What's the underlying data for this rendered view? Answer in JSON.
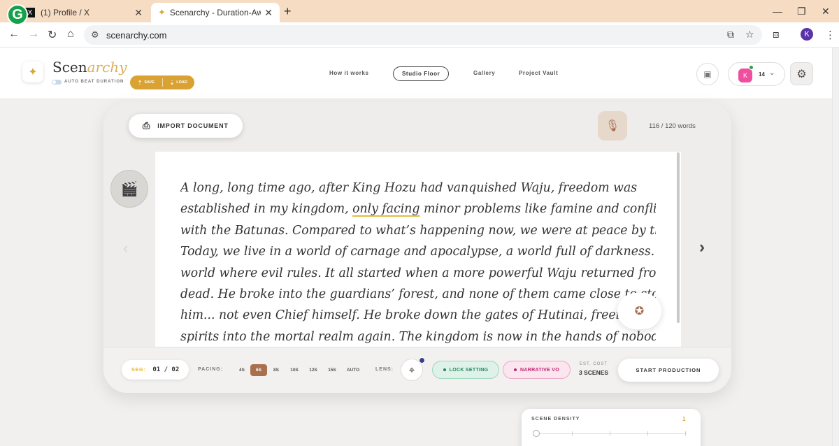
{
  "browser": {
    "tabs": [
      {
        "title": "(1) Profile / X",
        "favicon": "x-logo-icon"
      },
      {
        "title": "Scenarchy - Duration-Aware Vi",
        "favicon": "scenarchy-logo-icon"
      }
    ],
    "url": "scenarchy.com",
    "profile_initial": "K"
  },
  "header": {
    "brand_main": "Scen",
    "brand_accent": "archy",
    "auto_beat_label": "AUTO BEAT DURATION",
    "save_label": "SAVE",
    "load_label": "LOAD",
    "nav": [
      "How it works",
      "Studio Floor",
      "Gallery",
      "Project Vault"
    ],
    "active_nav": "Studio Floor",
    "user_initial": "K",
    "credits": "14"
  },
  "studio": {
    "import_label": "IMPORT DOCUMENT",
    "word_count": "116 / 120 words",
    "story_lines": [
      [
        "A long, long time ago, after King Hozu had vanquished Waju, freedom was",
        "",
        ""
      ],
      [
        "established in my kingdom, ",
        "only facing",
        " minor problems like famine and conflicts"
      ],
      [
        "with the Batunas. Compared to what’s happening now, we were at peace by then.",
        "",
        ""
      ],
      [
        "Today, we live in a world of carnage and apocalypse, a world full of darkness. A",
        "",
        ""
      ],
      [
        "world where evil rules. It all started when a more powerful Waju returned from the",
        "",
        ""
      ],
      [
        "dead. He broke into the guardians’ forest, and none of them came close to stoppin",
        "",
        ""
      ],
      [
        "him... not even Chief himself. He broke down the gates of Hutinai, freeing all the",
        "",
        ""
      ],
      [
        "spirits into the mortal realm again. The kingdom is now in the hands of nobody.",
        "",
        ""
      ]
    ]
  },
  "controls": {
    "seg_label": "SEG:",
    "seg_value": "01 / 02",
    "pacing_label": "PACING:",
    "pacing_options": [
      "4S",
      "6S",
      "8S",
      "10S",
      "12S",
      "15S",
      "AUTO"
    ],
    "pacing_selected": "6S",
    "lens_label": "LENS:",
    "lock_label": "LOCK SETTING",
    "vo_label": "NARRATIVE VO",
    "est_label": "EST. COST",
    "est_value": "3 SCENES",
    "start_label": "START PRODUCTION"
  },
  "density": {
    "title": "SCENE DENSITY",
    "value": "1",
    "level": 1
  },
  "colors": {
    "accent_gold": "#d9a233",
    "pacing_selected_bg": "#a9704e",
    "lock_green": "#218a5c",
    "vo_pink": "#c12670"
  }
}
